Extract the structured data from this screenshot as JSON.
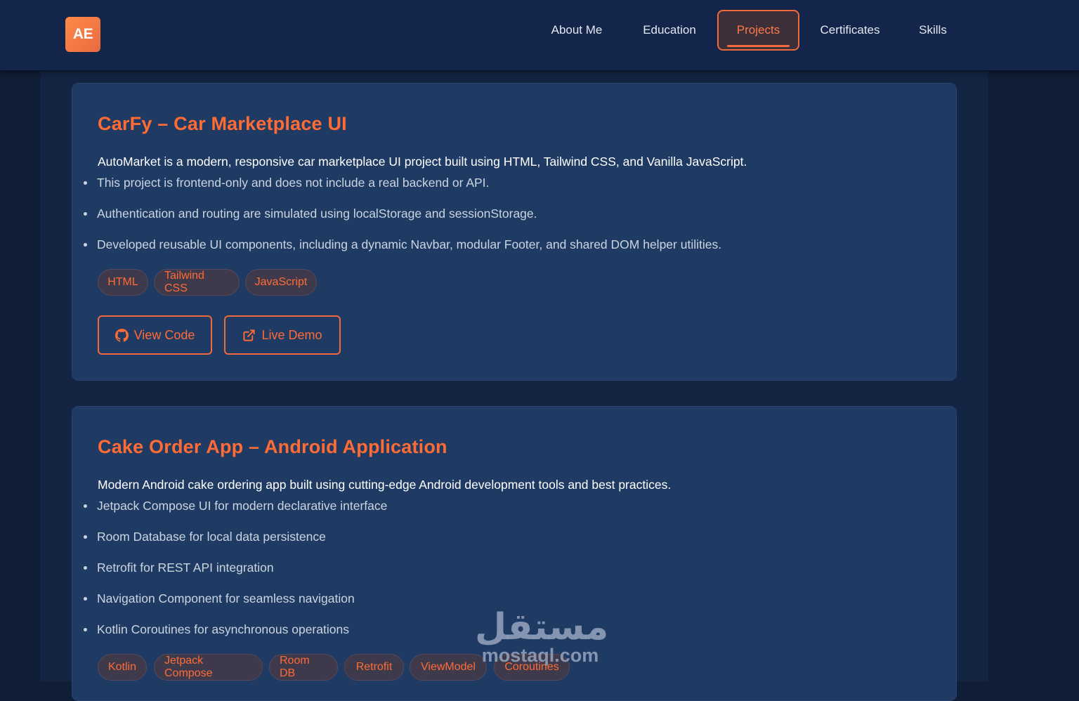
{
  "nav": {
    "logo": "AE",
    "items": [
      {
        "label": "About Me"
      },
      {
        "label": "Education"
      },
      {
        "label": "Projects",
        "active": true
      },
      {
        "label": "Certificates"
      },
      {
        "label": "Skills"
      }
    ]
  },
  "projects": [
    {
      "title": "CarFy – Car Marketplace UI",
      "description": "AutoMarket is a modern, responsive car marketplace UI project built using HTML, Tailwind CSS, and Vanilla JavaScript.",
      "bullets": [
        "This project is frontend-only and does not include a real backend or API.",
        "Authentication and routing are simulated using localStorage and sessionStorage.",
        "Developed reusable UI components, including a dynamic Navbar, modular Footer, and shared DOM helper utilities."
      ],
      "tags": [
        "HTML",
        "Tailwind CSS",
        "JavaScript"
      ],
      "buttons": {
        "view_code": "View Code",
        "live_demo": "Live Demo"
      }
    },
    {
      "title": "Cake Order App – Android Application",
      "description": "Modern Android cake ordering app built using cutting-edge Android development tools and best practices.",
      "bullets": [
        "Jetpack Compose UI for modern declarative interface",
        "Room Database for local data persistence",
        "Retrofit for REST API integration",
        "Navigation Component for seamless navigation",
        "Kotlin Coroutines for asynchronous operations"
      ],
      "tags": [
        "Kotlin",
        "Jetpack Compose",
        "Room DB",
        "Retrofit",
        "ViewModel",
        "Coroutines"
      ]
    }
  ],
  "watermark": {
    "arabic": "مستقل",
    "latin": "mostaql.com"
  },
  "colors": {
    "accent": "#ff6b35",
    "card_bg": "#1f3a63",
    "nav_bg": "#13254a",
    "page_bg": "#0f1e36"
  }
}
